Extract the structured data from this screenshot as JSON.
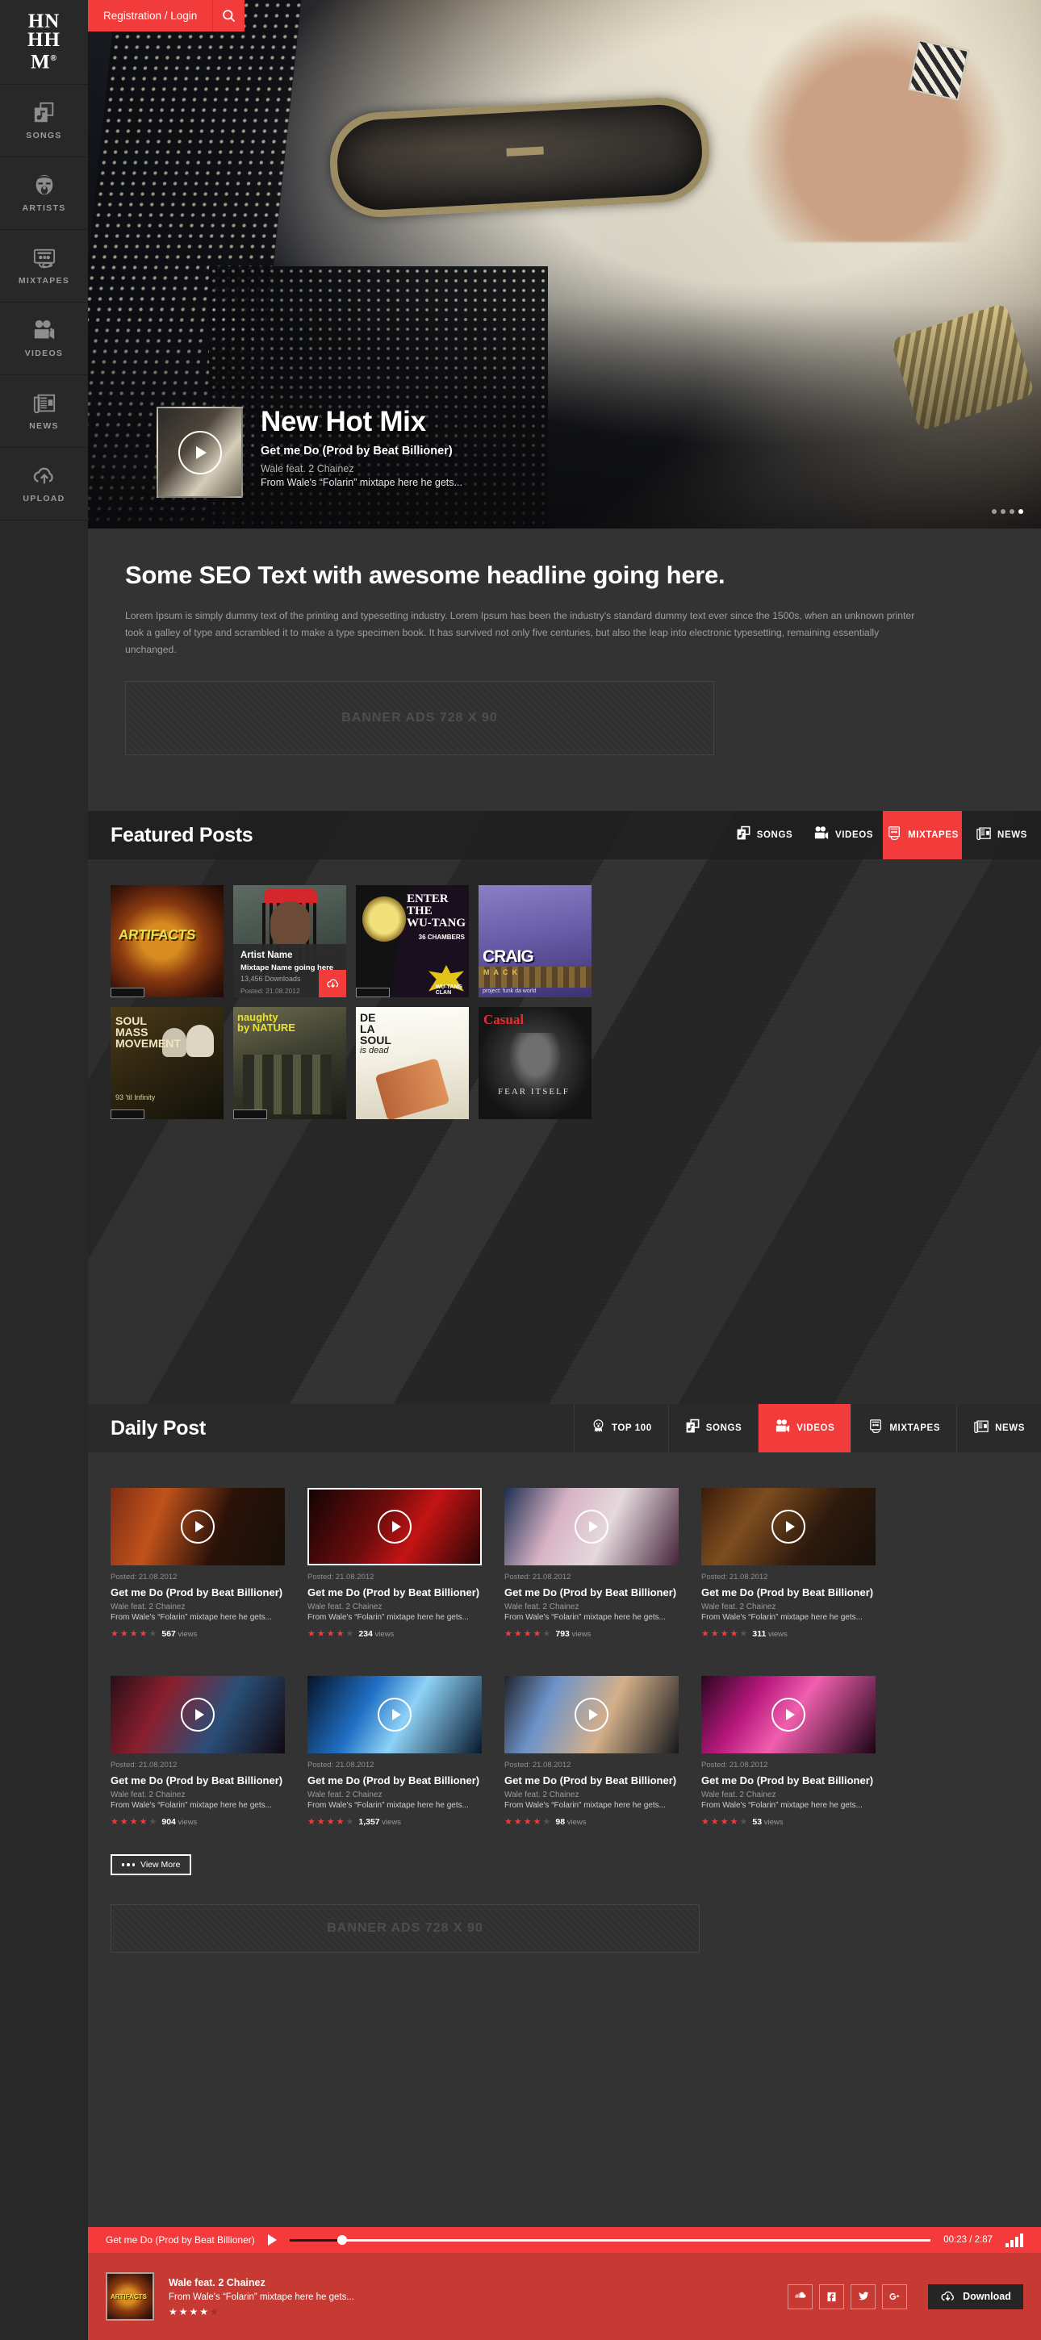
{
  "brand": {
    "line1": "HN",
    "line2": "HH",
    "line3": "M",
    "reg": "®"
  },
  "sidebar": {
    "items": [
      {
        "label": "SONGS",
        "icon": "songs-icon"
      },
      {
        "label": "ARTISTS",
        "icon": "artist-face-icon"
      },
      {
        "label": "MIXTAPES",
        "icon": "cassette-icon"
      },
      {
        "label": "VIDEOS",
        "icon": "video-camera-icon"
      },
      {
        "label": "NEWS",
        "icon": "newspaper-icon"
      },
      {
        "label": "UPLOAD",
        "icon": "cloud-upload-icon"
      }
    ]
  },
  "topbar": {
    "register_label": "Registration / Login",
    "search_icon": "search-icon"
  },
  "hero": {
    "title": "New Hot Mix",
    "subtitle": "Get me Do (Prod by Beat Billioner)",
    "artist": "Wale feat. 2 Chainez",
    "description": "From Wale's “Folarin” mixtape here he gets...",
    "dots": 4,
    "active_dot": 4
  },
  "seo": {
    "headline": "Some SEO Text with awesome headline going here.",
    "body": "Lorem Ipsum is simply dummy text of the printing and typesetting industry. Lorem Ipsum has been the industry's standard dummy text ever since the 1500s, when an unknown printer took a galley of type and scrambled it to make a type specimen book. It has survived not only five centuries, but also the leap into electronic typesetting, remaining essentially unchanged.",
    "banner": "BANNER ADS 728 X 90"
  },
  "featured": {
    "title": "Featured Posts",
    "tabs": [
      {
        "label": "SONGS",
        "icon": "songs-icon",
        "active": false
      },
      {
        "label": "VIDEOS",
        "icon": "video-camera-icon",
        "active": false
      },
      {
        "label": "MIXTAPES",
        "icon": "cassette-icon",
        "active": true
      },
      {
        "label": "NEWS",
        "icon": "newspaper-icon",
        "active": false
      }
    ],
    "overlay_card": {
      "artist": "Artist Name",
      "mixtape": "Mixtape Name going here",
      "downloads": "13,456 Downloads",
      "posted": "Posted: 21.08.2012",
      "download_icon": "cloud-download-icon"
    }
  },
  "daily": {
    "title": "Daily Post",
    "tabs": [
      {
        "label": "TOP 100",
        "icon": "medal-icon",
        "active": false
      },
      {
        "label": "SONGS",
        "icon": "songs-icon",
        "active": false
      },
      {
        "label": "VIDEOS",
        "icon": "video-camera-icon",
        "active": true
      },
      {
        "label": "MIXTAPES",
        "icon": "cassette-icon",
        "active": false
      },
      {
        "label": "NEWS",
        "icon": "newspaper-icon",
        "active": false
      }
    ],
    "cards": [
      {
        "posted": "Posted: 21.08.2012",
        "title": "Get me Do (Prod by Beat Billioner)",
        "artist": "Wale feat. 2 Chainez",
        "desc": "From Wale's “Folarin” mixtape here he gets...",
        "rating": 4,
        "views": "567",
        "views_label": "views"
      },
      {
        "posted": "Posted: 21.08.2012",
        "title": "Get me Do (Prod by Beat Billioner)",
        "artist": "Wale feat. 2 Chainez",
        "desc": "From Wale's “Folarin” mixtape here he gets...",
        "rating": 4,
        "views": "234",
        "views_label": "views"
      },
      {
        "posted": "Posted: 21.08.2012",
        "title": "Get me Do (Prod by Beat Billioner)",
        "artist": "Wale feat. 2 Chainez",
        "desc": "From Wale's “Folarin” mixtape here he gets...",
        "rating": 4,
        "views": "793",
        "views_label": "views"
      },
      {
        "posted": "Posted: 21.08.2012",
        "title": "Get me Do (Prod by Beat Billioner)",
        "artist": "Wale feat. 2 Chainez",
        "desc": "From Wale's “Folarin” mixtape here he gets...",
        "rating": 4,
        "views": "311",
        "views_label": "views"
      },
      {
        "posted": "Posted: 21.08.2012",
        "title": "Get me Do (Prod by Beat Billioner)",
        "artist": "Wale feat. 2 Chainez",
        "desc": "From Wale's “Folarin” mixtape here he gets...",
        "rating": 4,
        "views": "904",
        "views_label": "views"
      },
      {
        "posted": "Posted: 21.08.2012",
        "title": "Get me Do (Prod by Beat Billioner)",
        "artist": "Wale feat. 2 Chainez",
        "desc": "From Wale's “Folarin” mixtape here he gets...",
        "rating": 4,
        "views": "1,357",
        "views_label": "views"
      },
      {
        "posted": "Posted: 21.08.2012",
        "title": "Get me Do (Prod by Beat Billioner)",
        "artist": "Wale feat. 2 Chainez",
        "desc": "From Wale's “Folarin” mixtape here he gets...",
        "rating": 4,
        "views": "98",
        "views_label": "views"
      },
      {
        "posted": "Posted: 21.08.2012",
        "title": "Get me Do (Prod by Beat Billioner)",
        "artist": "Wale feat. 2 Chainez",
        "desc": "From Wale's “Folarin” mixtape here he gets...",
        "rating": 4,
        "views": "53",
        "views_label": "views"
      }
    ],
    "view_more": "View More",
    "banner": "BANNER ADS 728 X 90"
  },
  "player": {
    "track_title": "Get me Do (Prod by Beat Billioner)",
    "time": "00:23 / 2:87",
    "progress_pct": 7.5,
    "artist": "Wale feat. 2 Chainez",
    "desc": "From Wale's “Folarin” mixtape here he gets...",
    "rating": 4,
    "download_label": "Download",
    "social": [
      "soundcloud-icon",
      "facebook-icon",
      "twitter-icon",
      "googleplus-icon"
    ]
  },
  "colors": {
    "accent": "#f23b3b",
    "player_top": "#f43a3a",
    "player_bottom": "#c63a33",
    "bg": "#333333",
    "sidebar": "#282828"
  }
}
